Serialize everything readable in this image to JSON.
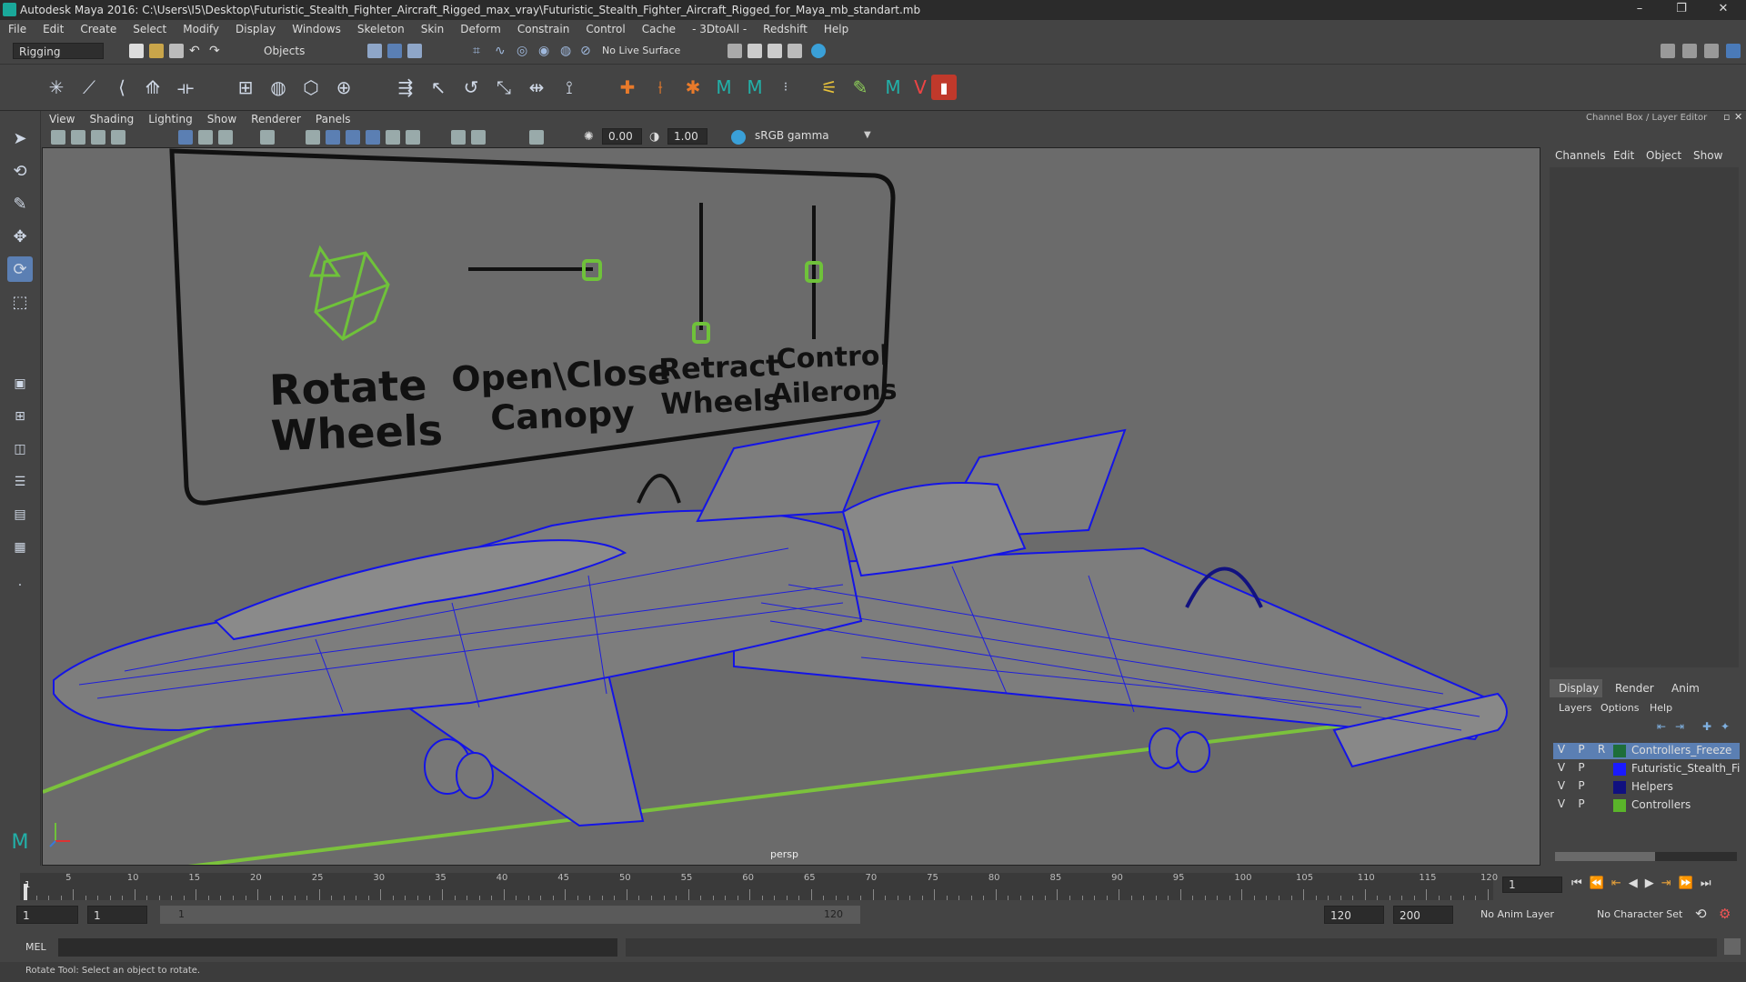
{
  "window": {
    "title": "Autodesk Maya 2016: C:\\Users\\I5\\Desktop\\Futuristic_Stealth_Fighter_Aircraft_Rigged_max_vray\\Futuristic_Stealth_Fighter_Aircraft_Rigged_for_Maya_mb_standart.mb",
    "minimize": "–",
    "restore": "❐",
    "close": "✕"
  },
  "menu": [
    "File",
    "Edit",
    "Create",
    "Select",
    "Modify",
    "Display",
    "Windows",
    "Skeleton",
    "Skin",
    "Deform",
    "Constrain",
    "Control",
    "Cache",
    "- 3DtoAll -",
    "Redshift",
    "Help"
  ],
  "statusline": {
    "menuset": "Rigging",
    "selection_mode": "Objects",
    "live_surface": "No Live Surface"
  },
  "viewport": {
    "menu": [
      "View",
      "Shading",
      "Lighting",
      "Show",
      "Renderer",
      "Panels"
    ],
    "exposure": "0.00",
    "gamma": "1.00",
    "colorspace": "sRGB gamma",
    "camera_label": "persp",
    "controller_labels": {
      "rotate_wheels": "Rotate\nWheels",
      "canopy": "Open\\Close\nCanopy",
      "retract": "Retract\nWheels",
      "ailerons": "Control\nAilerons"
    }
  },
  "right_panel": {
    "header": "Channel Box / Layer Editor",
    "cb_menu": [
      "Channels",
      "Edit",
      "Object",
      "Show"
    ],
    "tabs": [
      "Display",
      "Render",
      "Anim"
    ],
    "layer_menu": [
      "Layers",
      "Options",
      "Help"
    ],
    "layers": [
      {
        "v": "V",
        "p": "P",
        "r": "R",
        "name": "Controllers_Freeze",
        "color": "#1e6e3a",
        "selected": true
      },
      {
        "v": "V",
        "p": "P",
        "r": "",
        "name": "Futuristic_Stealth_Fighter",
        "color": "#1a1aff",
        "selected": false
      },
      {
        "v": "V",
        "p": "P",
        "r": "",
        "name": "Helpers",
        "color": "#101080",
        "selected": false
      },
      {
        "v": "V",
        "p": "P",
        "r": "",
        "name": "Controllers",
        "color": "#5ab52a",
        "selected": false
      }
    ]
  },
  "timeline": {
    "ticks": [
      "5",
      "10",
      "15",
      "20",
      "25",
      "30",
      "35",
      "40",
      "45",
      "50",
      "55",
      "60",
      "65",
      "70",
      "75",
      "80",
      "85",
      "90",
      "95",
      "100",
      "105",
      "110",
      "115",
      "120"
    ],
    "current_frame": "1",
    "start_marker": "1"
  },
  "range": {
    "start": "1",
    "playback_start": "1",
    "slider_start": "1",
    "slider_end": "120",
    "playback_end": "120",
    "end": "200",
    "anim_layer": "No Anim Layer",
    "character_set": "No Character Set"
  },
  "command": {
    "label": "MEL"
  },
  "help": {
    "text": "Rotate Tool: Select an object to rotate."
  },
  "colors": {
    "wire": "#1414e6",
    "controller": "#6fc23a",
    "ground": "#7bc23c"
  }
}
